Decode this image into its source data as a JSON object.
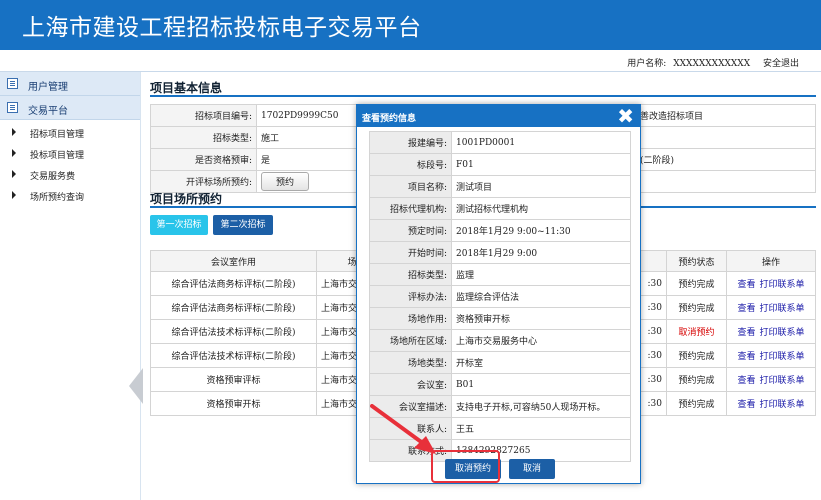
{
  "header": {
    "title": "上海市建设工程招标投标电子交易平台"
  },
  "userbar": {
    "label": "用户名称:",
    "name": "XXXXXXXXXXXX",
    "logout": "安全退出"
  },
  "sidebar": {
    "sections": [
      {
        "label": "用户管理"
      },
      {
        "label": "交易平台"
      }
    ],
    "items": [
      {
        "label": "招标项目管理"
      },
      {
        "label": "投标项目管理"
      },
      {
        "label": "交易服务费"
      },
      {
        "label": "场所预约查询"
      }
    ]
  },
  "project_info": {
    "title": "项目基本信息",
    "rows": [
      {
        "key": "招标项目编号:",
        "value": "1702PD9999C50",
        "right": "善改造招标项目"
      },
      {
        "key": "招标类型:",
        "value": "施工",
        "right": ""
      },
      {
        "key": "是否资格预审:",
        "value": "是",
        "right": "(二阶段)"
      },
      {
        "key": "开评标场所预约:",
        "value": "预约",
        "right": ""
      }
    ]
  },
  "venue": {
    "title": "项目场所预约",
    "tabs": [
      "第一次招标",
      "第二次招标"
    ],
    "headers": [
      "会议室作用",
      "场所",
      "",
      "预约状态",
      "操作"
    ],
    "rows": [
      {
        "purpose": "综合评估法商务标评标(二阶段)",
        "place": "上海市交",
        "time": ":30",
        "status": "预约完成",
        "status_red": false
      },
      {
        "purpose": "综合评估法商务标评标(二阶段)",
        "place": "上海市交",
        "time": ":30",
        "status": "预约完成",
        "status_red": false
      },
      {
        "purpose": "综合评估法技术标评标(二阶段)",
        "place": "上海市交",
        "time": ":30",
        "status": "取消预约",
        "status_red": true
      },
      {
        "purpose": "综合评估法技术标评标(二阶段)",
        "place": "上海市交",
        "time": ":30",
        "status": "预约完成",
        "status_red": false
      },
      {
        "purpose": "资格预审评标",
        "place": "上海市交",
        "time": ":30",
        "status": "预约完成",
        "status_red": false
      },
      {
        "purpose": "资格预审开标",
        "place": "上海市交",
        "time": ":30",
        "status": "预约完成",
        "status_red": false
      }
    ],
    "action_view": "查看",
    "action_print": "打印联系单"
  },
  "modal": {
    "title": "查看预约信息",
    "close": "✖",
    "rows": [
      {
        "key": "报建编号:",
        "value": "1001PD0001"
      },
      {
        "key": "标段号:",
        "value": "F01"
      },
      {
        "key": "项目名称:",
        "value": "测试项目"
      },
      {
        "key": "招标代理机构:",
        "value": "测试招标代理机构"
      },
      {
        "key": "预定时间:",
        "value": "2018年1月29 9:00~11:30"
      },
      {
        "key": "开始时间:",
        "value": "2018年1月29 9:00"
      },
      {
        "key": "招标类型:",
        "value": "监理"
      },
      {
        "key": "评标办法:",
        "value": "监理综合评估法"
      },
      {
        "key": "场地作用:",
        "value": "资格预审开标"
      },
      {
        "key": "场地所在区域:",
        "value": "上海市交易服务中心"
      },
      {
        "key": "场地类型:",
        "value": "开标室"
      },
      {
        "key": "会议室:",
        "value": "B01"
      },
      {
        "key": "会议室描述:",
        "value": "支持电子开标,可容纳50人现场开标。"
      },
      {
        "key": "联系人:",
        "value": "王五"
      },
      {
        "key": "联系方式:",
        "value": "1384292827265"
      }
    ],
    "btn_cancel_booking": "取消预约",
    "btn_cancel": "取消"
  },
  "colors": {
    "primary": "#1771c3",
    "tab_active": "#29c4ea",
    "tab_dark": "#1c5fa6",
    "highlight": "#e8303a"
  }
}
